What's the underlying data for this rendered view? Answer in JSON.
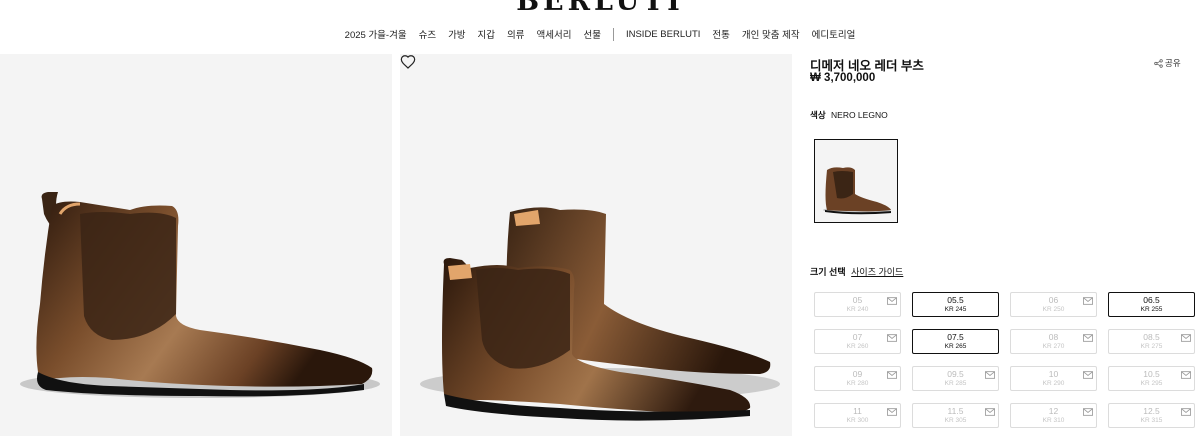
{
  "brand": {
    "logo": "BERLUTI"
  },
  "nav": {
    "items": [
      "2025 가을-겨울",
      "슈즈",
      "가방",
      "지갑",
      "의류",
      "액세서리",
      "선물"
    ],
    "items_right": [
      "INSIDE BERLUTI",
      "전통",
      "개인 맞춤 제작",
      "에디토리얼"
    ]
  },
  "product": {
    "title": "디메저 네오 레더 부츠",
    "price": "₩ 3,700,000",
    "share_label": "공유",
    "color_label": "색상",
    "color_value": "NERO LEGNO",
    "size_label": "크기 선택",
    "size_guide": "사이즈 가이드"
  },
  "sizes": [
    {
      "size": "05",
      "kr": "KR 240",
      "available": false
    },
    {
      "size": "05.5",
      "kr": "KR 245",
      "available": true
    },
    {
      "size": "06",
      "kr": "KR 250",
      "available": false
    },
    {
      "size": "06.5",
      "kr": "KR 255",
      "available": true
    },
    {
      "size": "07",
      "kr": "KR 260",
      "available": false
    },
    {
      "size": "07.5",
      "kr": "KR 265",
      "available": true
    },
    {
      "size": "08",
      "kr": "KR 270",
      "available": false
    },
    {
      "size": "08.5",
      "kr": "KR 275",
      "available": false
    },
    {
      "size": "09",
      "kr": "KR 280",
      "available": false
    },
    {
      "size": "09.5",
      "kr": "KR 285",
      "available": false
    },
    {
      "size": "10",
      "kr": "KR 290",
      "available": false
    },
    {
      "size": "10.5",
      "kr": "KR 295",
      "available": false
    },
    {
      "size": "11",
      "kr": "KR 300",
      "available": false
    },
    {
      "size": "11.5",
      "kr": "KR 305",
      "available": false
    },
    {
      "size": "12",
      "kr": "KR 310",
      "available": false
    },
    {
      "size": "12.5",
      "kr": "KR 315",
      "available": false
    }
  ],
  "icons": {
    "wishlist": "heart-icon",
    "share": "share-icon",
    "notify": "mail-icon"
  },
  "colors": {
    "leather_dark": "#3a2414",
    "leather_mid": "#7a4e2c",
    "leather_light": "#a77a52",
    "gallery_bg": "#f4f4f4"
  }
}
